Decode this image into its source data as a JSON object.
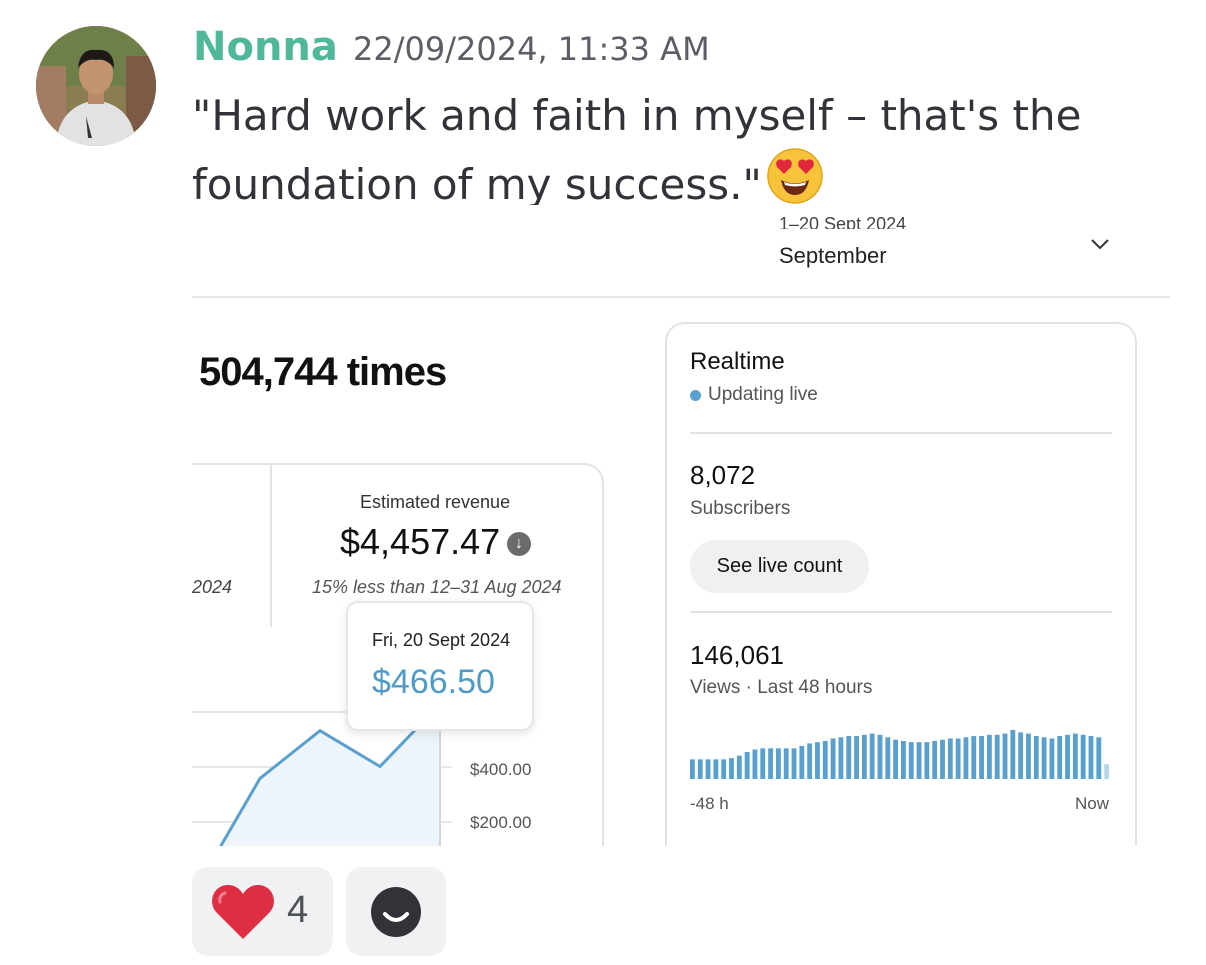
{
  "message": {
    "author": "Nonna",
    "timestamp": "22/09/2024, 11:33 AM",
    "text": "\"Hard work and faith in myself – that's the foundation of my success.\"",
    "emoji": "heart-eyes-emoji"
  },
  "screenshot": {
    "period_sub": "1–20 Sept 2024",
    "period": "September",
    "view_count": "504,744 times",
    "left_date_fragment": "2024",
    "revenue": {
      "label": "Estimated revenue",
      "value": "$4,457.47",
      "comparison": "15% less than 12–31 Aug 2024",
      "tooltip_date": "Fri, 20 Sept 2024",
      "tooltip_value": "$466.50",
      "axis_labels": [
        "$400.00",
        "$200.00"
      ]
    },
    "realtime": {
      "title": "Realtime",
      "status": "Updating live",
      "subscribers_value": "8,072",
      "subscribers_label": "Subscribers",
      "live_button": "See live count",
      "views_value": "146,061",
      "views_label": "Views · Last 48 hours",
      "axis_start": "-48 h",
      "axis_end": "Now"
    }
  },
  "chart_data": [
    {
      "type": "area",
      "series": [
        {
          "values": [
            20,
            280,
            400,
            310,
            466.5
          ]
        }
      ],
      "ylim": [
        100,
        540
      ],
      "yticks": [
        "$400.00",
        "$200.00"
      ],
      "highlight": {
        "date": "Fri, 20 Sept 2024",
        "value": 466.5
      }
    },
    {
      "type": "bar",
      "title": "Views · Last 48 hours",
      "values": [
        16,
        16,
        16,
        16,
        16,
        17,
        19,
        22,
        24,
        25,
        25,
        25,
        25,
        25,
        27,
        29,
        30,
        31,
        33,
        34,
        35,
        35,
        36,
        37,
        36,
        34,
        32,
        31,
        30,
        30,
        30,
        31,
        32,
        33,
        33,
        34,
        35,
        35,
        36,
        36,
        37,
        40,
        38,
        37,
        35,
        34,
        33,
        35,
        36,
        37,
        36,
        35,
        34,
        12
      ],
      "xlabel_start": "-48 h",
      "xlabel_end": "Now"
    }
  ],
  "reactions": [
    {
      "emoji": "heart",
      "count": "4"
    }
  ],
  "colors": {
    "username": "#4fb89a",
    "accent_blue": "#4e9bc8",
    "bar_blue": "#5aa0cf",
    "reaction_bg": "#f0f1f3"
  }
}
